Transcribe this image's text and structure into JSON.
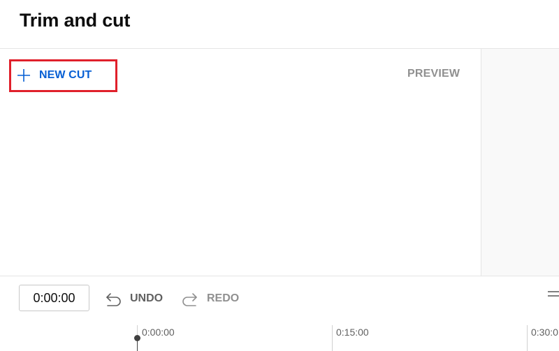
{
  "header": {
    "title": "Trim and cut"
  },
  "editor": {
    "new_cut_label": "NEW CUT",
    "preview_label": "PREVIEW",
    "highlight_color": "#e0202b",
    "accent_color": "#065fd4"
  },
  "toolbar": {
    "time_value": "0:00:00",
    "undo_label": "UNDO",
    "redo_label": "REDO",
    "icons": {
      "undo": "undo-arrow-icon",
      "redo": "redo-arrow-icon",
      "new_cut": "plus-icon",
      "menu": "menu-icon"
    }
  },
  "timeline": {
    "ticks": [
      "0:00:00",
      "0:15:00",
      "0:30:0"
    ]
  }
}
